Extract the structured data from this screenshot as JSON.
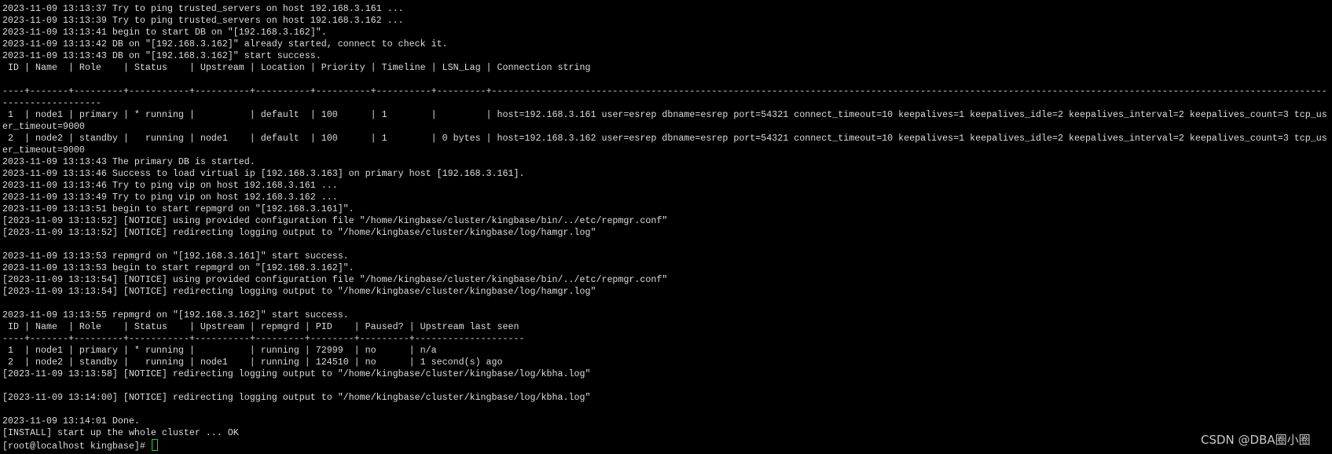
{
  "terminal": {
    "lines": [
      "2023-11-09 13:13:37 Try to ping trusted_servers on host 192.168.3.161 ...",
      "2023-11-09 13:13:39 Try to ping trusted_servers on host 192.168.3.162 ...",
      "2023-11-09 13:13:41 begin to start DB on \"[192.168.3.162]\".",
      "2023-11-09 13:13:42 DB on \"[192.168.3.162]\" already started, connect to check it.",
      "2023-11-09 13:13:43 DB on \"[192.168.3.162]\" start success.",
      " ID | Name  | Role    | Status    | Upstream | Location | Priority | Timeline | LSN_Lag | Connection string",
      "",
      "----+-------+---------+-----------+----------+----------+----------+----------+---------+--------------------------------------------------------------------------------------------------------------------------------------------------------------------------",
      " 1  | node1 | primary | * running |          | default  | 100      | 1        |         | host=192.168.3.161 user=esrep dbname=esrep port=54321 connect_timeout=10 keepalives=1 keepalives_idle=2 keepalives_interval=2 keepalives_count=3 tcp_user_timeout=9000",
      " 2  | node2 | standby |   running | node1    | default  | 100      | 1        | 0 bytes | host=192.168.3.162 user=esrep dbname=esrep port=54321 connect_timeout=10 keepalives=1 keepalives_idle=2 keepalives_interval=2 keepalives_count=3 tcp_user_timeout=9000",
      "2023-11-09 13:13:43 The primary DB is started.",
      "2023-11-09 13:13:46 Success to load virtual ip [192.168.3.163] on primary host [192.168.3.161].",
      "2023-11-09 13:13:46 Try to ping vip on host 192.168.3.161 ...",
      "2023-11-09 13:13:49 Try to ping vip on host 192.168.3.162 ...",
      "2023-11-09 13:13:51 begin to start repmgrd on \"[192.168.3.161]\".",
      "[2023-11-09 13:13:52] [NOTICE] using provided configuration file \"/home/kingbase/cluster/kingbase/bin/../etc/repmgr.conf\"",
      "[2023-11-09 13:13:52] [NOTICE] redirecting logging output to \"/home/kingbase/cluster/kingbase/log/hamgr.log\"",
      "",
      "2023-11-09 13:13:53 repmgrd on \"[192.168.3.161]\" start success.",
      "2023-11-09 13:13:53 begin to start repmgrd on \"[192.168.3.162]\".",
      "[2023-11-09 13:13:54] [NOTICE] using provided configuration file \"/home/kingbase/cluster/kingbase/bin/../etc/repmgr.conf\"",
      "[2023-11-09 13:13:54] [NOTICE] redirecting logging output to \"/home/kingbase/cluster/kingbase/log/hamgr.log\"",
      "",
      "2023-11-09 13:13:55 repmgrd on \"[192.168.3.162]\" start success.",
      " ID | Name  | Role    | Status    | Upstream | repmgrd | PID    | Paused? | Upstream last seen",
      "----+-------+---------+-----------+----------+---------+--------+---------+--------------------",
      " 1  | node1 | primary | * running |          | running | 72999  | no      | n/a",
      " 2  | node2 | standby |   running | node1    | running | 124510 | no      | 1 second(s) ago",
      "[2023-11-09 13:13:58] [NOTICE] redirecting logging output to \"/home/kingbase/cluster/kingbase/log/kbha.log\"",
      "",
      "[2023-11-09 13:14:00] [NOTICE] redirecting logging output to \"/home/kingbase/cluster/kingbase/log/kbha.log\"",
      "",
      "2023-11-09 13:14:01 Done.",
      "[INSTALL] start up the whole cluster ... OK"
    ],
    "prompt": "[root@localhost kingbase]# ",
    "cursor_color": "#2bd12b"
  },
  "watermark": "CSDN @DBA圈小圈"
}
